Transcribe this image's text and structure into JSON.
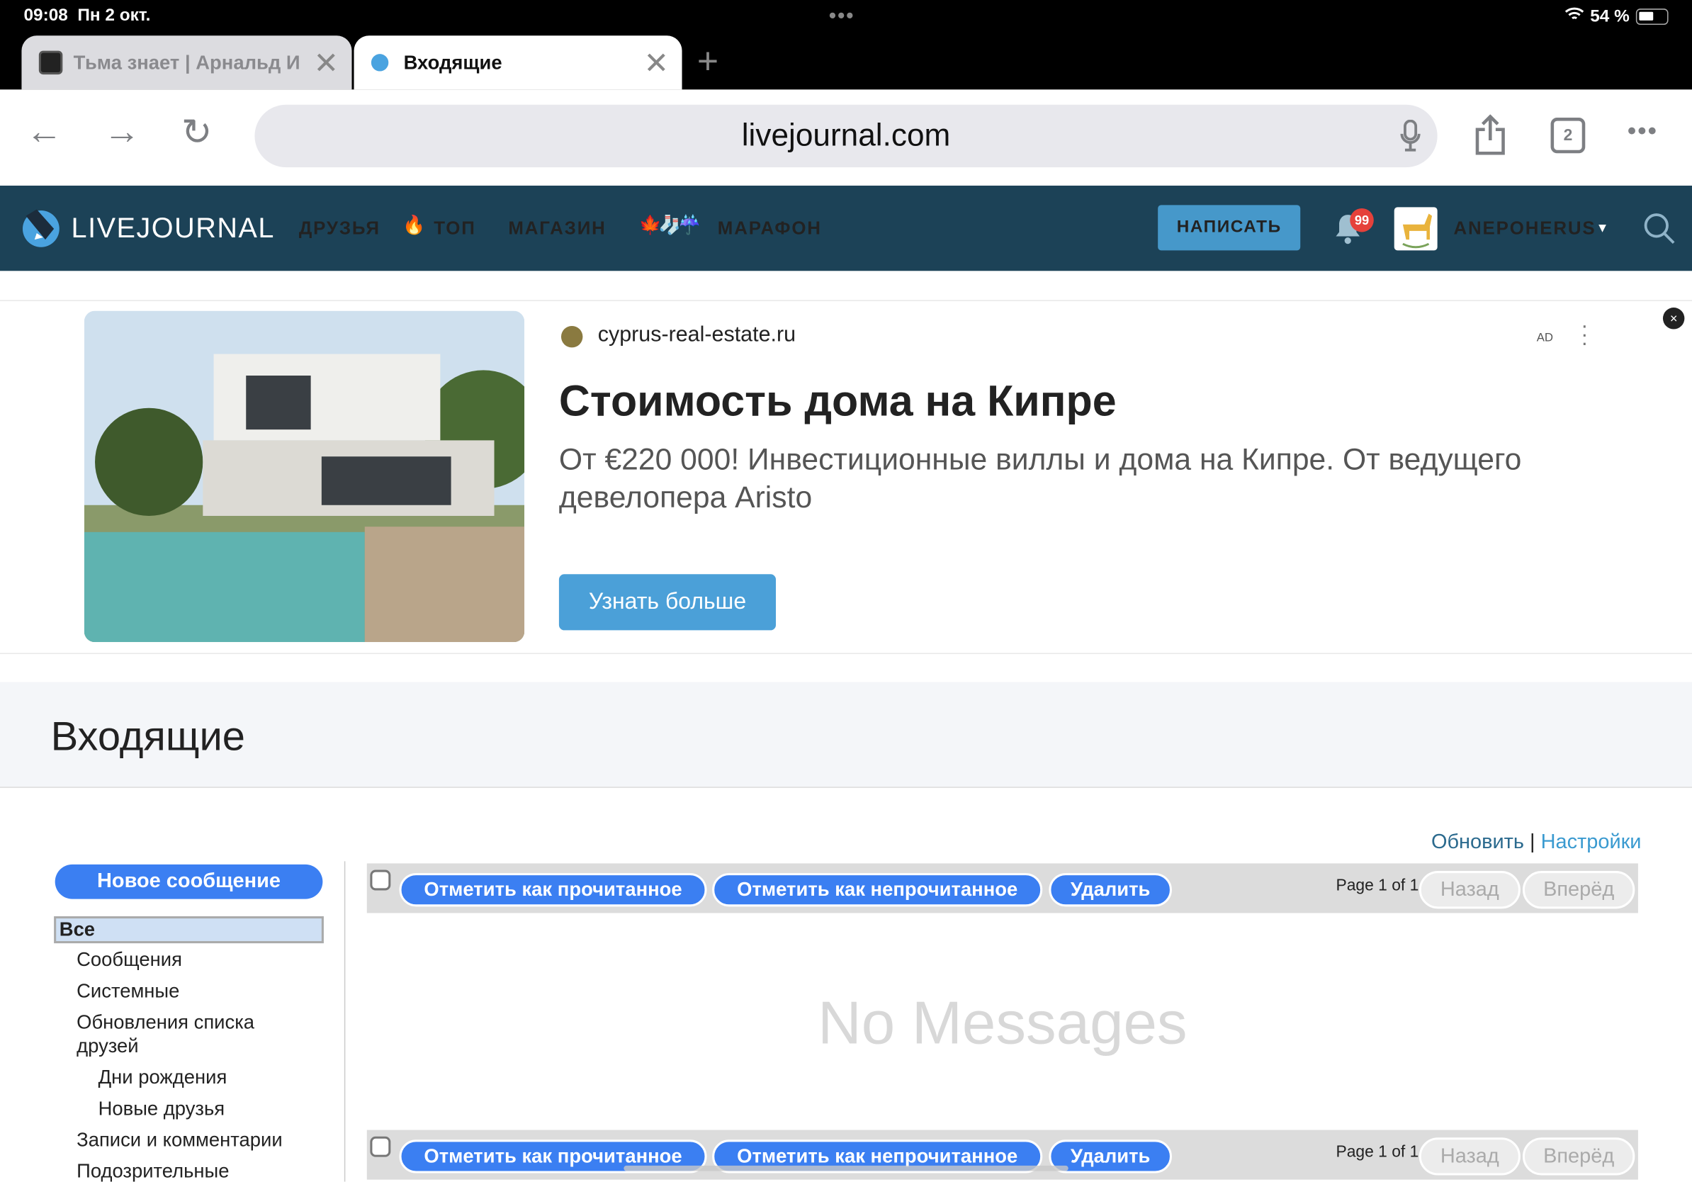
{
  "status_bar": {
    "time": "09:08",
    "date": "Пн 2 окт.",
    "battery": "54 %",
    "battery_level": 0.54
  },
  "tabs": [
    {
      "title": "Тьма знает | Арнальд И",
      "active": false
    },
    {
      "title": "Входящие",
      "active": true
    }
  ],
  "address_bar": {
    "url": "livejournal.com",
    "tab_count": "2"
  },
  "lj_nav": {
    "logo": "LIVEJOURNAL",
    "items": [
      "ДРУЗЬЯ",
      "ТОП",
      "МАГАЗИН",
      "МАРАФОН"
    ],
    "top_emoji": "🔥",
    "marathon_emoji": "🍁🧦☔",
    "write": "НАПИСАТЬ",
    "notifications": "99",
    "username": "ANEPOHERUS",
    "colors": {
      "nav_bg": "#1c4257",
      "write_bg": "#4698ca",
      "badge": "#e5413b"
    }
  },
  "ad": {
    "domain": "cyprus-real-estate.ru",
    "label": "AD",
    "title": "Стоимость дома на Кипре",
    "description": "От €220 000! Инвестиционные виллы и дома на Кипре. От ведущего девелопера Aristo",
    "cta": "Узнать больше",
    "close": "×"
  },
  "page": {
    "title": "Входящие",
    "refresh": "Обновить",
    "separator": "|",
    "settings": "Настройки"
  },
  "sidebar": {
    "new_message": "Новое сообщение",
    "items": [
      {
        "label": "Все",
        "selected": true
      },
      {
        "label": "Сообщения"
      },
      {
        "label": "Системные"
      },
      {
        "label": "Обновления списка друзей"
      },
      {
        "label": "Дни рождения"
      },
      {
        "label": "Новые друзья"
      },
      {
        "label": "Записи и комментарии"
      },
      {
        "label": "Подозрительные"
      }
    ]
  },
  "actions": {
    "mark_read": "Отметить как прочитанное",
    "mark_unread": "Отметить как непрочитанное",
    "delete": "Удалить",
    "page_info": "Page 1 of 1",
    "prev": "Назад",
    "next": "Вперёд"
  },
  "empty_state": "No Messages",
  "colors": {
    "button_blue": "#3b7ff2",
    "selected_bg": "#cfe0f4"
  }
}
